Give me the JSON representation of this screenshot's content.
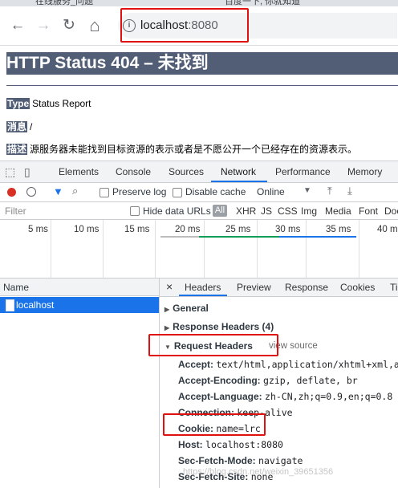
{
  "browser": {
    "tabs": [
      "在线服务_问题",
      "百度一下, 你就知道"
    ],
    "url_host": "localhost",
    "url_port": ":8080",
    "nav": {
      "back_icon": "←",
      "forward_icon": "→",
      "reload_icon": "↻",
      "home_icon": "⌂"
    }
  },
  "page": {
    "title": "HTTP Status 404 – 未找到",
    "type_label": "Type",
    "type_value": "Status Report",
    "message_label": "消息",
    "message_value": "/",
    "desc_label": "描述",
    "desc_value": "源服务器未能找到目标资源的表示或者是不愿公开一个已经存在的资源表示。"
  },
  "devtools": {
    "tabs": [
      "Elements",
      "Console",
      "Sources",
      "Network",
      "Performance",
      "Memory"
    ],
    "active_tab": "Network",
    "toolbar": {
      "preserve_log": "Preserve log",
      "disable_cache": "Disable cache",
      "throttle": "Online"
    },
    "filter": {
      "placeholder": "Filter",
      "hide_data_urls": "Hide data URLs",
      "types": [
        "All",
        "XHR",
        "JS",
        "CSS",
        "Img",
        "Media",
        "Font",
        "Doc"
      ]
    },
    "timeline_labels": [
      "5 ms",
      "10 ms",
      "15 ms",
      "20 ms",
      "25 ms",
      "30 ms",
      "35 ms",
      "40 m"
    ],
    "requests": {
      "header": "Name",
      "items": [
        "localhost"
      ]
    },
    "details": {
      "tabs": [
        "Headers",
        "Preview",
        "Response",
        "Cookies",
        "Ti"
      ],
      "sections": {
        "general": "General",
        "response_headers": "Response Headers (4)",
        "request_headers": "Request Headers",
        "view_source": "view source"
      },
      "request_headers": [
        {
          "name": "Accept:",
          "value": "text/html,application/xhtml+xml,ap"
        },
        {
          "name": "Accept-Encoding:",
          "value": "gzip, deflate, br"
        },
        {
          "name": "Accept-Language:",
          "value": "zh-CN,zh;q=0.9,en;q=0.8"
        },
        {
          "name": "Connection:",
          "value": "keep-alive"
        },
        {
          "name": "Cookie:",
          "value": "name=lrc"
        },
        {
          "name": "Host:",
          "value": "localhost:8080"
        },
        {
          "name": "Sec-Fetch-Mode:",
          "value": "navigate"
        },
        {
          "name": "Sec-Fetch-Site:",
          "value": "none"
        }
      ]
    }
  },
  "watermark": "https://blog.csdn.net/weixin_39651356",
  "colors": {
    "annotation_red": "#e01010",
    "tomcat_header": "#525d76",
    "devtools_accent": "#1a73e8"
  }
}
